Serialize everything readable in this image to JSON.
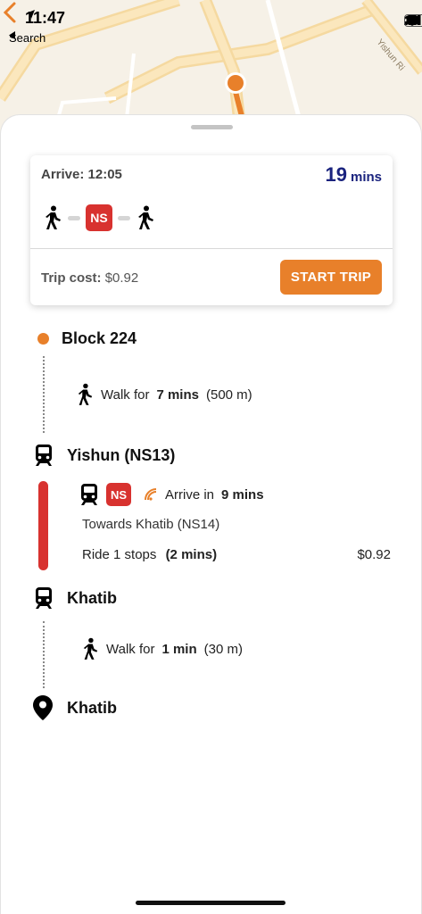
{
  "status_bar": {
    "time": "11:47",
    "back_label": "Search"
  },
  "map": {
    "road_label": "Yishun Ri"
  },
  "summary": {
    "arrive_label": "Arrive:",
    "arrive_time": "12:05",
    "duration_value": "19",
    "duration_unit": "mins",
    "line_badge": "NS",
    "trip_cost_label": "Trip cost:",
    "trip_cost_value": "$0.92",
    "start_button": "START TRIP"
  },
  "itinerary": {
    "origin": "Block 224",
    "walk1": {
      "prefix": "Walk for",
      "duration": "7 mins",
      "distance": "(500 m)"
    },
    "board_station": "Yishun (NS13)",
    "ride": {
      "line_badge": "NS",
      "arrive_prefix": "Arrive in",
      "arrive_time": "9 mins",
      "towards": "Towards Khatib (NS14)",
      "stops": "Ride 1 stops",
      "duration": "(2 mins)",
      "fare": "$0.92"
    },
    "alight_station": "Khatib",
    "walk2": {
      "prefix": "Walk for",
      "duration": "1 min",
      "distance": "(30 m)"
    },
    "destination": "Khatib"
  },
  "colors": {
    "accent": "#e8802a",
    "line_red": "#d8322f",
    "duration_blue": "#1a237e"
  },
  "icons": [
    "location-arrow-icon",
    "back-triangle-icon",
    "signal-icon",
    "wifi-icon",
    "battery-icon",
    "map-back-chevron-icon",
    "walking-icon",
    "train-icon",
    "live-signal-icon",
    "location-pin-icon"
  ]
}
